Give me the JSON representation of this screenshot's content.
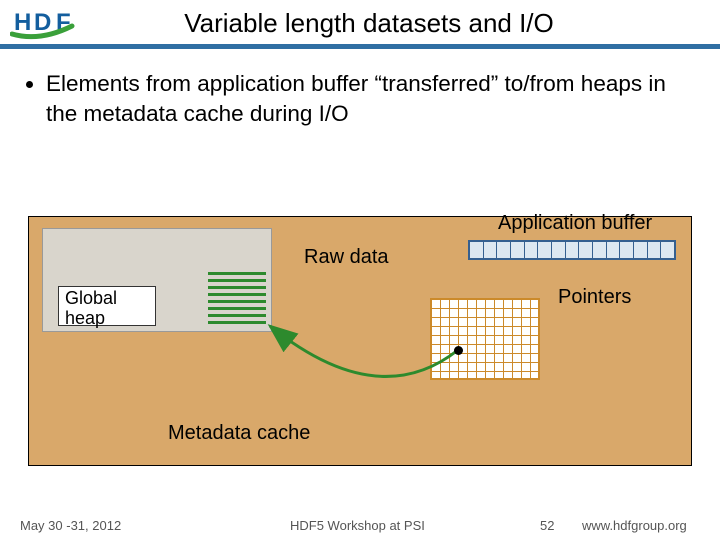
{
  "header": {
    "title": "Variable length datasets and I/O",
    "logo_text": "HDF"
  },
  "bullet": "Elements from application buffer “transferred” to/from heaps in the metadata cache during I/O",
  "diagram": {
    "app_buffer": "Application buffer",
    "raw_data": "Raw data",
    "global_heap": "Global heap",
    "pointers": "Pointers",
    "metadata_cache": "Metadata cache"
  },
  "footer": {
    "date": "May 30 -31, 2012",
    "mid": "HDF5 Workshop at PSI",
    "page": "52",
    "url": "www.hdfgroup.org"
  }
}
